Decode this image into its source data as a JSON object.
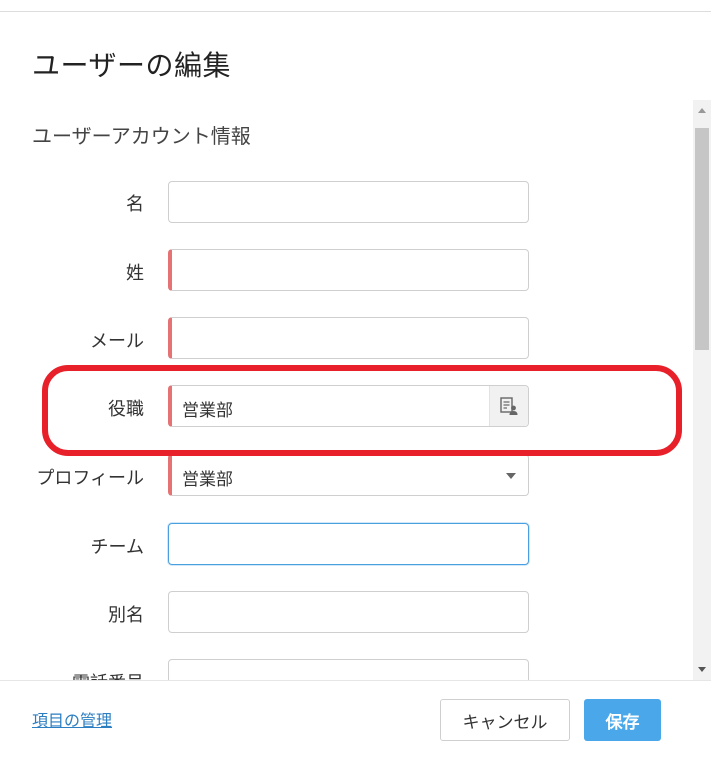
{
  "dialog": {
    "title": "ユーザーの編集"
  },
  "section": {
    "title": "ユーザーアカウント情報"
  },
  "fields": {
    "first_name": {
      "label": "名",
      "value": ""
    },
    "last_name": {
      "label": "姓",
      "value": ""
    },
    "email": {
      "label": "メール",
      "value": ""
    },
    "role": {
      "label": "役職",
      "value": "営業部",
      "lookup_icon": "user-list-icon"
    },
    "profile": {
      "label": "プロフィール",
      "value": "営業部"
    },
    "team": {
      "label": "チーム",
      "value": ""
    },
    "alias": {
      "label": "別名",
      "value": ""
    },
    "phone": {
      "label": "電話番号",
      "value": ""
    }
  },
  "footer": {
    "manage_link": "項目の管理",
    "cancel_label": "キャンセル",
    "save_label": "保存"
  },
  "colors": {
    "accent": "#4aa8ea",
    "required_marker": "#e57373",
    "highlight": "#e8202a",
    "link": "#2b7ec1"
  }
}
